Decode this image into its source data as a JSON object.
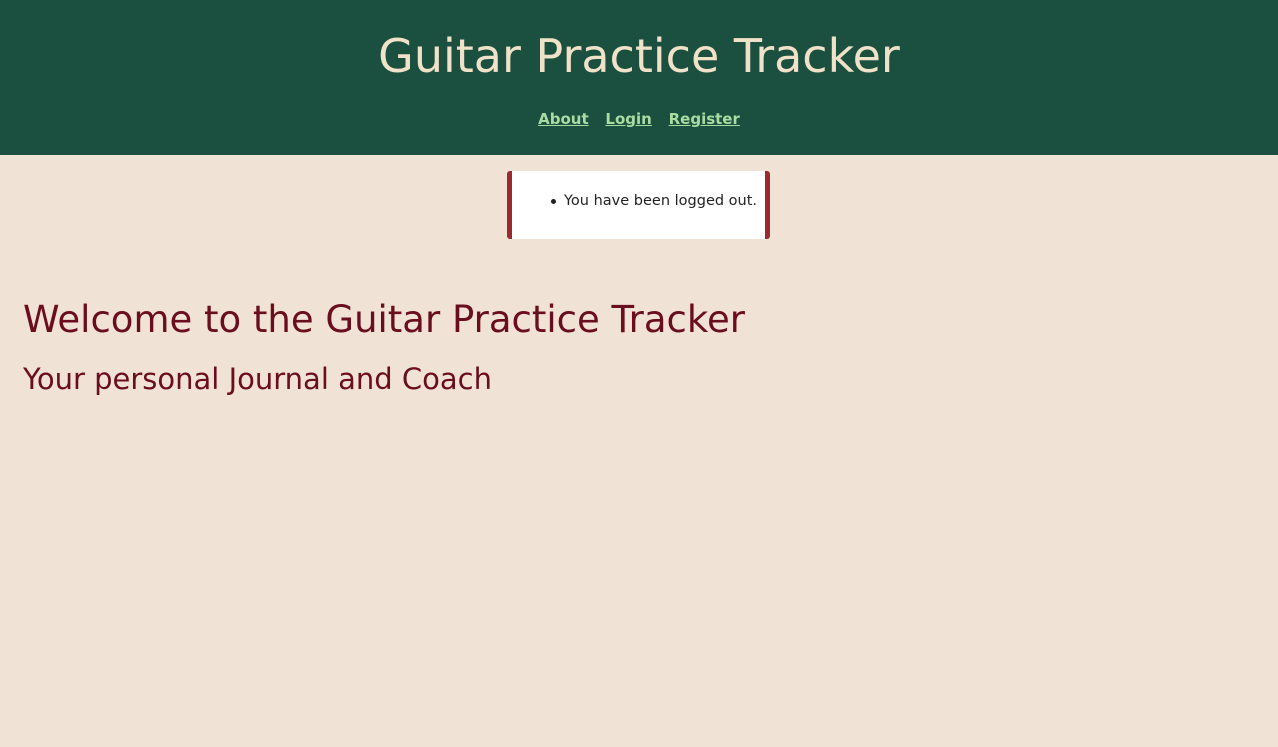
{
  "header": {
    "title": "Guitar Practice Tracker",
    "nav": [
      {
        "label": "About"
      },
      {
        "label": "Login"
      },
      {
        "label": "Register"
      }
    ]
  },
  "flash": {
    "messages": [
      "You have been logged out."
    ]
  },
  "main": {
    "heading": "Welcome to the Guitar Practice Tracker",
    "subheading": "Your personal Journal and Coach"
  },
  "colors": {
    "header_bg": "#1b4f40",
    "page_bg": "#f0e2d4",
    "heading": "#6a0d1e",
    "nav_link": "#a8dca0",
    "flash_border": "#9b2930"
  }
}
